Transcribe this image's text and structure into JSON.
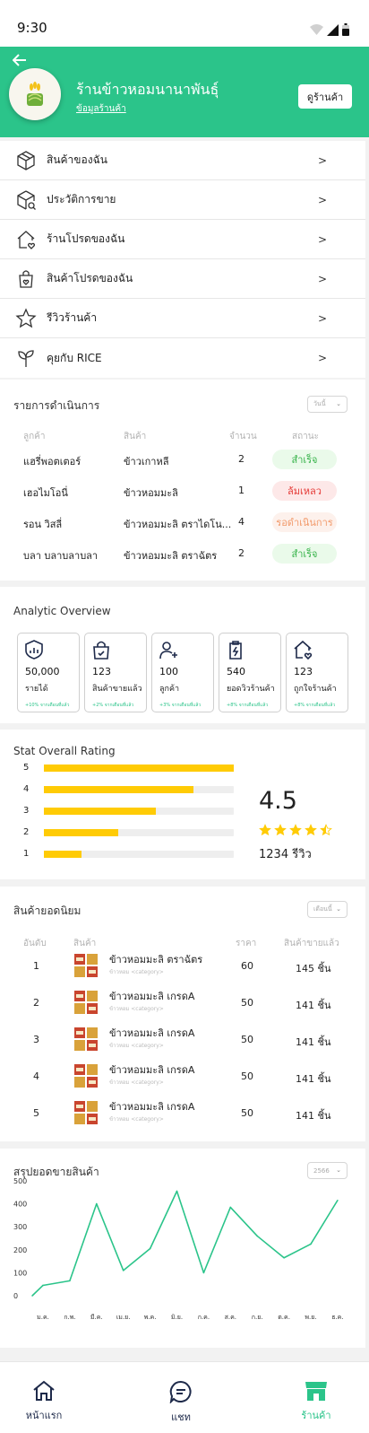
{
  "status_bar": {
    "time": "9:30"
  },
  "header": {
    "shop_name": "ร้านข้าวหอมนานาพันธุ์",
    "shop_info_link": "ข้อมูลร้านค้า",
    "view_shop_button": "ดูร้านค้า",
    "brand_color": "#2bc48a"
  },
  "menu": [
    {
      "label": "สินค้าของฉัน",
      "icon": "box-icon",
      "arrow": ">"
    },
    {
      "label": "ประวัติการขาย",
      "icon": "box-search-icon",
      "arrow": ">"
    },
    {
      "label": "ร้านโปรดของฉัน",
      "icon": "home-heart-icon",
      "arrow": ">"
    },
    {
      "label": "สินค้าโปรดของฉัน",
      "icon": "bag-heart-icon",
      "arrow": ">"
    },
    {
      "label": "รีวิวร้านค้า",
      "icon": "star-icon",
      "arrow": ">"
    },
    {
      "label": "คุยกับ RICE",
      "icon": "sprout-icon",
      "arrow": ">"
    }
  ],
  "orders": {
    "title": "รายการดำเนินการ",
    "filter": "วันนี้",
    "headers": {
      "customer": "ลูกค้า",
      "product": "สินค้า",
      "qty": "จำนวน",
      "status": "สถานะ"
    },
    "rows": [
      {
        "customer": "แฮรี่พอตเตอร์",
        "product": "ข้าวเกาหลี",
        "qty": "2",
        "status": "สำเร็จ",
        "status_type": "success"
      },
      {
        "customer": "เฮอไมโอนี่",
        "product": "ข้าวหอมมะลิ",
        "qty": "1",
        "status": "ล้มเหลว",
        "status_type": "fail"
      },
      {
        "customer": "รอน วิสลี่",
        "product": "ข้าวหอมมะลิ ตราไดโน...",
        "qty": "4",
        "status": "รอดำเนินการ",
        "status_type": "pending"
      },
      {
        "customer": "บลา บลาบลาบลา",
        "product": "ข้าวหอมมะลิ ตราฉัตร",
        "qty": "2",
        "status": "สำเร็จ",
        "status_type": "success"
      }
    ],
    "status_colors": {
      "success": {
        "bg": "#eafaea",
        "fg": "#37b34a"
      },
      "fail": {
        "bg": "#fde8e8",
        "fg": "#e53935"
      },
      "pending": {
        "bg": "#fdf1ec",
        "fg": "#f29a6b"
      }
    }
  },
  "analytic": {
    "title": "Analytic Overview",
    "cards": [
      {
        "icon": "chart-shield-icon",
        "value": "50,000",
        "label": "รายได้",
        "note": "+10% จากเดือนที่แล้ว"
      },
      {
        "icon": "bag-check-icon",
        "value": "123",
        "label": "สินค้าขายแล้ว",
        "note": "+2% จากเดือนที่แล้ว"
      },
      {
        "icon": "user-plus-icon",
        "value": "100",
        "label": "ลูกค้า",
        "note": "+3% จากเดือนที่แล้ว"
      },
      {
        "icon": "clipboard-bolt-icon",
        "value": "540",
        "label": "ยอดวิวร้านค้า",
        "note": "+8% จากเดือนที่แล้ว"
      },
      {
        "icon": "home-heart-icon",
        "value": "123",
        "label": "ถูกใจร้านค้า",
        "note": "+8% จากเดือนที่แล้ว"
      }
    ]
  },
  "rating": {
    "title": "Stat Overall Rating",
    "average": "4.5",
    "review_count": "1234 รีวิว",
    "stars": 4.5,
    "bars": [
      {
        "stars": "5",
        "fraction": 1.0
      },
      {
        "stars": "4",
        "fraction": 0.79
      },
      {
        "stars": "3",
        "fraction": 0.59
      },
      {
        "stars": "2",
        "fraction": 0.39
      },
      {
        "stars": "1",
        "fraction": 0.2
      }
    ],
    "bar_color": "#ffcb05"
  },
  "top_products": {
    "title": "สินค้ายอดนิยม",
    "filter": "เดือนนี้",
    "headers": {
      "rank": "อันดับ",
      "product": "สินค้า",
      "price": "ราคา",
      "sold": "สินค้าขายแล้ว"
    },
    "rows": [
      {
        "rank": "1",
        "name": "ข้าวหอมมะลิ ตราฉัตร",
        "category": "ข้าวหอม <category>",
        "price": "60",
        "sold": "145 ชิ้น"
      },
      {
        "rank": "2",
        "name": "ข้าวหอมมะลิ เกรดA",
        "category": "ข้าวหอม <category>",
        "price": "50",
        "sold": "141 ชิ้น"
      },
      {
        "rank": "3",
        "name": "ข้าวหอมมะลิ เกรดA",
        "category": "ข้าวหอม <category>",
        "price": "50",
        "sold": "141 ชิ้น"
      },
      {
        "rank": "4",
        "name": "ข้าวหอมมะลิ เกรดA",
        "category": "ข้าวหอม <category>",
        "price": "50",
        "sold": "141 ชิ้น"
      },
      {
        "rank": "5",
        "name": "ข้าวหอมมะลิ เกรดA",
        "category": "ข้าวหอม <category>",
        "price": "50",
        "sold": "141 ชิ้น"
      }
    ]
  },
  "sales": {
    "title": "สรุปยอดขายสินค้า",
    "filter": "2566"
  },
  "chart_data": {
    "type": "line",
    "title": "",
    "xlabel": "",
    "ylabel": "",
    "categories": [
      "",
      "ม.ค.",
      "",
      "ก.พ.",
      "มี.ค.",
      "เม.ย.",
      "",
      "พ.ค.",
      "มิ.ย.",
      "ก.ค.",
      "ส.ค.",
      "ก.ย.",
      "ต.ค.",
      "พ.ย.",
      "ธ.ค."
    ],
    "x": [
      0.0,
      0.4,
      1.0,
      1.5,
      2.0,
      3.0,
      3.5,
      4.0,
      5.0,
      6.0,
      7.0,
      8.0,
      9.0,
      10.0,
      11.0
    ],
    "x_ticks": [
      "ม.ค.",
      "ก.พ.",
      "มี.ค.",
      "เม.ย.",
      "พ.ค.",
      "มิ.ย.",
      "ก.ค.",
      "ส.ค.",
      "ก.ย.",
      "ต.ค.",
      "พ.ย.",
      "ธ.ค."
    ],
    "series": [
      {
        "x": [
          -0.4,
          0.0,
          1.0,
          2.0,
          3.0,
          4.0,
          5.0,
          6.0,
          7.0,
          8.0,
          9.0,
          10.0,
          11.0
        ],
        "values": [
          0,
          45,
          65,
          400,
          110,
          205,
          455,
          100,
          385,
          260,
          165,
          225,
          415
        ]
      }
    ],
    "ylim": [
      0,
      500
    ],
    "y_ticks": [
      0,
      100,
      200,
      300,
      400,
      500
    ],
    "grid": false,
    "line_color": "#2bc48a"
  },
  "bottom_nav": [
    {
      "label": "หน้าแรก",
      "icon": "home-icon",
      "active": false
    },
    {
      "label": "แชท",
      "icon": "chat-icon",
      "active": false
    },
    {
      "label": "ร้านค้า",
      "icon": "store-icon",
      "active": true
    }
  ]
}
